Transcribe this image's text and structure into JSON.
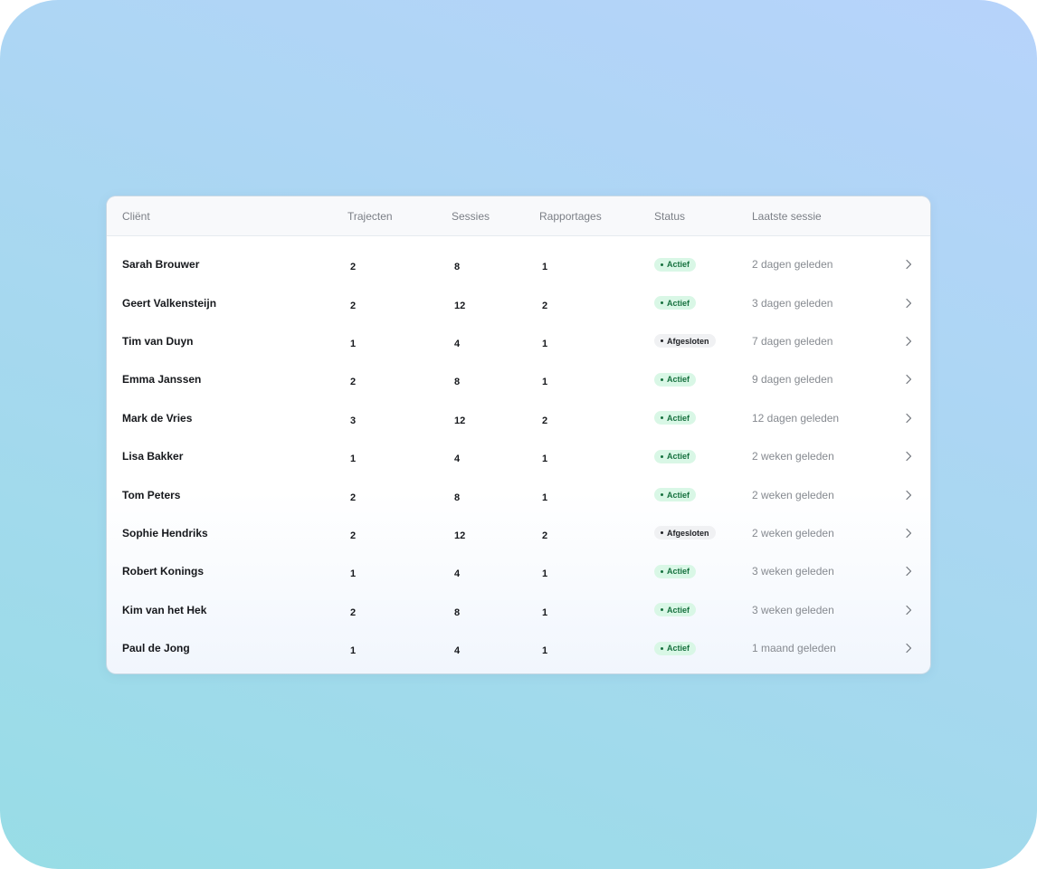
{
  "table": {
    "headers": {
      "client": "Cliënt",
      "trajecten": "Trajecten",
      "sessies": "Sessies",
      "rapportages": "Rapportages",
      "status": "Status",
      "laatste_sessie": "Laatste sessie"
    },
    "rows": [
      {
        "client": "Sarah Brouwer",
        "trajecten": "2",
        "sessies": "8",
        "rapportages": "1",
        "status": "Actief",
        "status_type": "actief",
        "laatste_sessie": "2 dagen geleden"
      },
      {
        "client": "Geert Valkensteijn",
        "trajecten": "2",
        "sessies": "12",
        "rapportages": "2",
        "status": "Actief",
        "status_type": "actief",
        "laatste_sessie": "3 dagen geleden"
      },
      {
        "client": "Tim van Duyn",
        "trajecten": "1",
        "sessies": "4",
        "rapportages": "1",
        "status": "Afgesloten",
        "status_type": "afgesloten",
        "laatste_sessie": "7 dagen geleden"
      },
      {
        "client": "Emma Janssen",
        "trajecten": "2",
        "sessies": "8",
        "rapportages": "1",
        "status": "Actief",
        "status_type": "actief",
        "laatste_sessie": "9 dagen geleden"
      },
      {
        "client": "Mark de Vries",
        "trajecten": "3",
        "sessies": "12",
        "rapportages": "2",
        "status": "Actief",
        "status_type": "actief",
        "laatste_sessie": "12 dagen geleden"
      },
      {
        "client": "Lisa Bakker",
        "trajecten": "1",
        "sessies": "4",
        "rapportages": "1",
        "status": "Actief",
        "status_type": "actief",
        "laatste_sessie": "2 weken geleden"
      },
      {
        "client": "Tom Peters",
        "trajecten": "2",
        "sessies": "8",
        "rapportages": "1",
        "status": "Actief",
        "status_type": "actief",
        "laatste_sessie": "2 weken geleden"
      },
      {
        "client": "Sophie Hendriks",
        "trajecten": "2",
        "sessies": "12",
        "rapportages": "2",
        "status": "Afgesloten",
        "status_type": "afgesloten",
        "laatste_sessie": "2 weken geleden"
      },
      {
        "client": "Robert Konings",
        "trajecten": "1",
        "sessies": "4",
        "rapportages": "1",
        "status": "Actief",
        "status_type": "actief",
        "laatste_sessie": "3 weken geleden"
      },
      {
        "client": "Kim van het Hek",
        "trajecten": "2",
        "sessies": "8",
        "rapportages": "1",
        "status": "Actief",
        "status_type": "actief",
        "laatste_sessie": "3 weken geleden"
      },
      {
        "client": "Paul de Jong",
        "trajecten": "1",
        "sessies": "4",
        "rapportages": "1",
        "status": "Actief",
        "status_type": "actief",
        "laatste_sessie": "1 maand geleden"
      }
    ]
  },
  "icons": {
    "row_action": "chevron-right-icon",
    "status_marker": "dot-icon"
  },
  "colors": {
    "status_actief_bg": "#d9f7e6",
    "status_actief_text": "#17713f",
    "status_afgesloten_bg": "#f0f1f3",
    "status_afgesloten_text": "#202226"
  }
}
